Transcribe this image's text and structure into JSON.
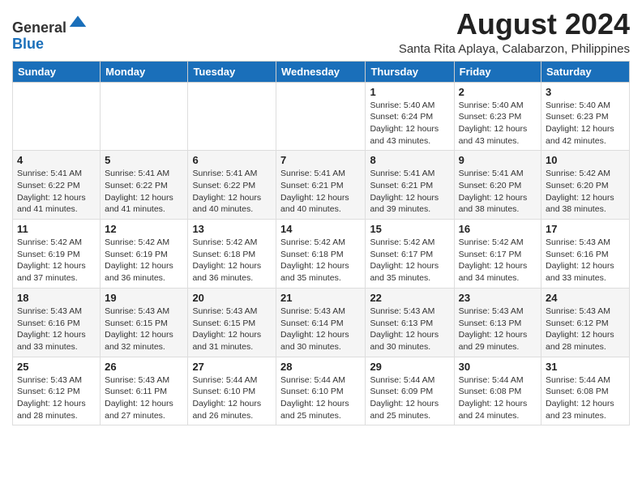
{
  "header": {
    "logo_line1": "General",
    "logo_line2": "Blue",
    "month_year": "August 2024",
    "location": "Santa Rita Aplaya, Calabarzon, Philippines"
  },
  "days_of_week": [
    "Sunday",
    "Monday",
    "Tuesday",
    "Wednesday",
    "Thursday",
    "Friday",
    "Saturday"
  ],
  "weeks": [
    [
      {
        "day": "",
        "info": ""
      },
      {
        "day": "",
        "info": ""
      },
      {
        "day": "",
        "info": ""
      },
      {
        "day": "",
        "info": ""
      },
      {
        "day": "1",
        "info": "Sunrise: 5:40 AM\nSunset: 6:24 PM\nDaylight: 12 hours and 43 minutes."
      },
      {
        "day": "2",
        "info": "Sunrise: 5:40 AM\nSunset: 6:23 PM\nDaylight: 12 hours and 43 minutes."
      },
      {
        "day": "3",
        "info": "Sunrise: 5:40 AM\nSunset: 6:23 PM\nDaylight: 12 hours and 42 minutes."
      }
    ],
    [
      {
        "day": "4",
        "info": "Sunrise: 5:41 AM\nSunset: 6:22 PM\nDaylight: 12 hours and 41 minutes."
      },
      {
        "day": "5",
        "info": "Sunrise: 5:41 AM\nSunset: 6:22 PM\nDaylight: 12 hours and 41 minutes."
      },
      {
        "day": "6",
        "info": "Sunrise: 5:41 AM\nSunset: 6:22 PM\nDaylight: 12 hours and 40 minutes."
      },
      {
        "day": "7",
        "info": "Sunrise: 5:41 AM\nSunset: 6:21 PM\nDaylight: 12 hours and 40 minutes."
      },
      {
        "day": "8",
        "info": "Sunrise: 5:41 AM\nSunset: 6:21 PM\nDaylight: 12 hours and 39 minutes."
      },
      {
        "day": "9",
        "info": "Sunrise: 5:41 AM\nSunset: 6:20 PM\nDaylight: 12 hours and 38 minutes."
      },
      {
        "day": "10",
        "info": "Sunrise: 5:42 AM\nSunset: 6:20 PM\nDaylight: 12 hours and 38 minutes."
      }
    ],
    [
      {
        "day": "11",
        "info": "Sunrise: 5:42 AM\nSunset: 6:19 PM\nDaylight: 12 hours and 37 minutes."
      },
      {
        "day": "12",
        "info": "Sunrise: 5:42 AM\nSunset: 6:19 PM\nDaylight: 12 hours and 36 minutes."
      },
      {
        "day": "13",
        "info": "Sunrise: 5:42 AM\nSunset: 6:18 PM\nDaylight: 12 hours and 36 minutes."
      },
      {
        "day": "14",
        "info": "Sunrise: 5:42 AM\nSunset: 6:18 PM\nDaylight: 12 hours and 35 minutes."
      },
      {
        "day": "15",
        "info": "Sunrise: 5:42 AM\nSunset: 6:17 PM\nDaylight: 12 hours and 35 minutes."
      },
      {
        "day": "16",
        "info": "Sunrise: 5:42 AM\nSunset: 6:17 PM\nDaylight: 12 hours and 34 minutes."
      },
      {
        "day": "17",
        "info": "Sunrise: 5:43 AM\nSunset: 6:16 PM\nDaylight: 12 hours and 33 minutes."
      }
    ],
    [
      {
        "day": "18",
        "info": "Sunrise: 5:43 AM\nSunset: 6:16 PM\nDaylight: 12 hours and 33 minutes."
      },
      {
        "day": "19",
        "info": "Sunrise: 5:43 AM\nSunset: 6:15 PM\nDaylight: 12 hours and 32 minutes."
      },
      {
        "day": "20",
        "info": "Sunrise: 5:43 AM\nSunset: 6:15 PM\nDaylight: 12 hours and 31 minutes."
      },
      {
        "day": "21",
        "info": "Sunrise: 5:43 AM\nSunset: 6:14 PM\nDaylight: 12 hours and 30 minutes."
      },
      {
        "day": "22",
        "info": "Sunrise: 5:43 AM\nSunset: 6:13 PM\nDaylight: 12 hours and 30 minutes."
      },
      {
        "day": "23",
        "info": "Sunrise: 5:43 AM\nSunset: 6:13 PM\nDaylight: 12 hours and 29 minutes."
      },
      {
        "day": "24",
        "info": "Sunrise: 5:43 AM\nSunset: 6:12 PM\nDaylight: 12 hours and 28 minutes."
      }
    ],
    [
      {
        "day": "25",
        "info": "Sunrise: 5:43 AM\nSunset: 6:12 PM\nDaylight: 12 hours and 28 minutes."
      },
      {
        "day": "26",
        "info": "Sunrise: 5:43 AM\nSunset: 6:11 PM\nDaylight: 12 hours and 27 minutes."
      },
      {
        "day": "27",
        "info": "Sunrise: 5:44 AM\nSunset: 6:10 PM\nDaylight: 12 hours and 26 minutes."
      },
      {
        "day": "28",
        "info": "Sunrise: 5:44 AM\nSunset: 6:10 PM\nDaylight: 12 hours and 25 minutes."
      },
      {
        "day": "29",
        "info": "Sunrise: 5:44 AM\nSunset: 6:09 PM\nDaylight: 12 hours and 25 minutes."
      },
      {
        "day": "30",
        "info": "Sunrise: 5:44 AM\nSunset: 6:08 PM\nDaylight: 12 hours and 24 minutes."
      },
      {
        "day": "31",
        "info": "Sunrise: 5:44 AM\nSunset: 6:08 PM\nDaylight: 12 hours and 23 minutes."
      }
    ]
  ]
}
